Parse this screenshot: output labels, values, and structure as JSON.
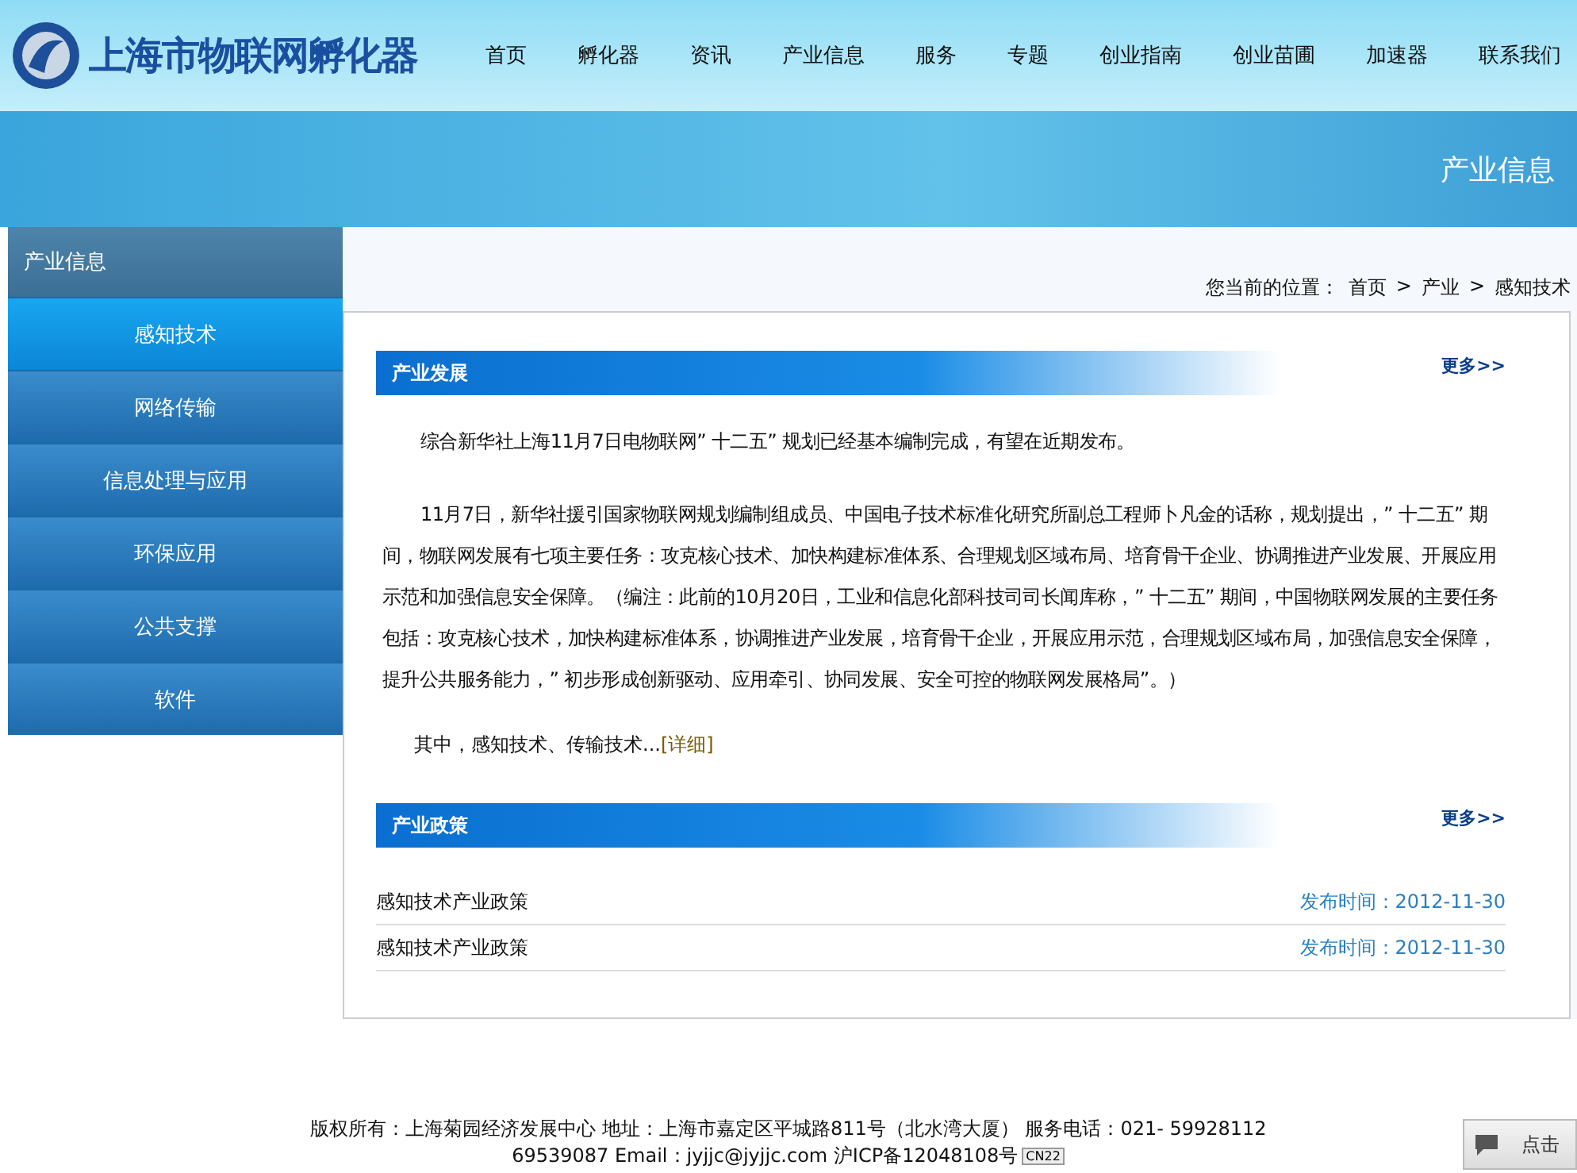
{
  "logo": {
    "text": "上海市物联网孵化器"
  },
  "nav": [
    "首页",
    "孵化器",
    "资讯",
    "产业信息",
    "服务",
    "专题",
    "创业指南",
    "创业苗圃",
    "加速器",
    "联系我们"
  ],
  "banner": {
    "title": "产业信息"
  },
  "sidebar": {
    "title": "产业信息",
    "items": [
      {
        "label": "感知技术",
        "selected": true
      },
      {
        "label": "网络传输",
        "selected": false
      },
      {
        "label": "信息处理与应用",
        "selected": false
      },
      {
        "label": "环保应用",
        "selected": false
      },
      {
        "label": "公共支撑",
        "selected": false
      },
      {
        "label": "软件",
        "selected": false
      }
    ]
  },
  "breadcrumb": {
    "prefix": "您当前的位置：",
    "separator": ">",
    "items": [
      "首页",
      "产业",
      "感知技术"
    ]
  },
  "sections": [
    {
      "kind": "article",
      "title": "产业发展",
      "more": "更多>>",
      "paragraphs": [
        "综合新华社上海11月7日电物联网” 十二五” 规划已经基本编制完成，有望在近期发布。",
        "11月7日，新华社援引国家物联网规划编制组成员、中国电子技术标准化研究所副总工程师卜凡金的话称，规划提出，” 十二五” 期间，物联网发展有七项主要任务：攻克核心技术、加快构建标准体系、合理规划区域布局、培育骨干企业、协调推进产业发展、开展应用示范和加强信息安全保障。（编注：此前的10月20日，工业和信息化部科技司司长闻库称，” 十二五” 期间，中国物联网发展的主要任务包括：攻克核心技术，加快构建标准体系，协调推进产业发展，培育骨干企业，开展应用示范，合理规划区域布局，加强信息安全保障，提升公共服务能力，” 初步形成创新驱动、应用牵引、协同发展、安全可控的物联网发展格局”。）"
      ],
      "lead": "其中，感知技术、传输技术...",
      "detail": "[详细]"
    },
    {
      "kind": "list",
      "title": "产业政策",
      "more": "更多>>",
      "rows": [
        {
          "title": "感知技术产业政策",
          "date": "发布时间：2012-11-30"
        },
        {
          "title": "感知技术产业政策",
          "date": "发布时间：2012-11-30"
        }
      ]
    }
  ],
  "footer": {
    "line1": "版权所有：上海菊园经济发展中心  地址：上海市嘉定区平城路811号（北水湾大厦） 服务电话：021- 59928112",
    "line2": "69539087 Email：jyjjc@jyjjc.com 沪ICP备12048108号",
    "badge": "CN22"
  },
  "float_widget": {
    "label": "点击"
  }
}
